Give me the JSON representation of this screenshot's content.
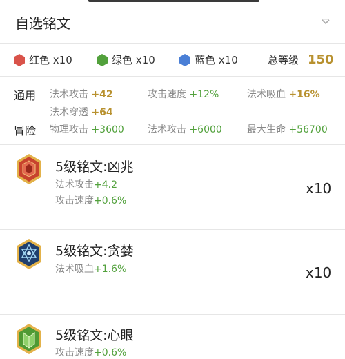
{
  "header": {
    "title": "自选铭文"
  },
  "colors": {
    "red": {
      "label": "红色 x10",
      "color": "#d9534a"
    },
    "green": {
      "label": "绿色 x10",
      "color": "#52a13c"
    },
    "blue": {
      "label": "蓝色 x10",
      "color": "#4a7fd6"
    },
    "level_label": "总等级",
    "level_value": "150"
  },
  "stats": {
    "general": {
      "label": "通用",
      "items": [
        {
          "name": "法术攻击",
          "value": "+42"
        },
        {
          "name": "攻击速度",
          "value": "+12%"
        },
        {
          "name": "法术吸血",
          "value": "+16%"
        },
        {
          "name": "法术穿透",
          "value": "+64"
        }
      ]
    },
    "adventure": {
      "label": "冒险",
      "items": [
        {
          "name": "物理攻击",
          "value": "+3600"
        },
        {
          "name": "法术攻击",
          "value": "+6000"
        },
        {
          "name": "最大生命",
          "value": "+56700"
        }
      ]
    }
  },
  "cards": [
    {
      "name": "5级铭文:凶兆",
      "attrs": [
        {
          "name": "法术攻击",
          "value": "+4.2"
        },
        {
          "name": "攻击速度",
          "value": "+0.6%"
        }
      ],
      "count": "x10",
      "color": "#c8432e"
    },
    {
      "name": "5级铭文:贪婪",
      "attrs": [
        {
          "name": "法术吸血",
          "value": "+1.6%"
        }
      ],
      "count": "x10",
      "color": "#3b6fb8"
    },
    {
      "name": "5级铭文:心眼",
      "attrs": [
        {
          "name": "攻击速度",
          "value": "+0.6%"
        }
      ],
      "count": "",
      "color": "#4f9a34"
    }
  ]
}
